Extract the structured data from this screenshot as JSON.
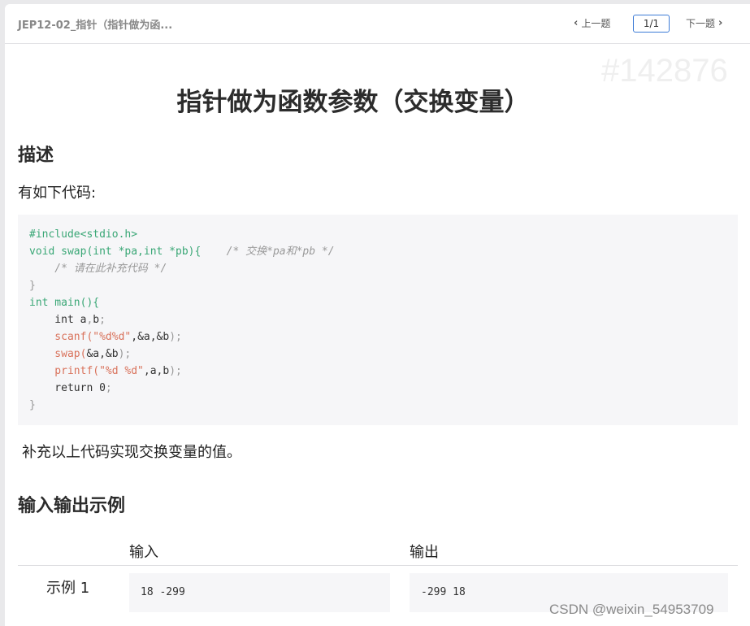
{
  "header": {
    "breadcrumb": "JEP12-02_指针（指针做为函...",
    "prev_label": "上一题",
    "prev_icon": "chevron-left-icon",
    "page_indicator": "1/1",
    "next_label": "下一题",
    "next_icon": "chevron-right-icon",
    "accent_color": "#3d7bd6"
  },
  "problem": {
    "id_watermark": "#142876",
    "title": "指针做为函数参数（交换变量）",
    "description_heading": "描述",
    "intro_text": "有如下代码:",
    "code_lines": [
      [
        {
          "t": "#include<stdio.h>",
          "c": "g"
        }
      ],
      [
        {
          "t": "void swap(int *pa,int *pb){",
          "c": "g"
        },
        {
          "t": "    /* 交换*pa和*pb */",
          "c": "cm"
        }
      ],
      [
        {
          "t": "    /* 请在此补充代码 */",
          "c": "cm"
        }
      ],
      [
        {
          "t": "}",
          "c": "gray"
        }
      ],
      [
        {
          "t": "int",
          "c": "kw"
        },
        {
          "t": " main(){",
          "c": "g"
        }
      ],
      [
        {
          "t": "    int a",
          "c": ""
        },
        {
          "t": ",",
          "c": "gray"
        },
        {
          "t": "b",
          "c": ""
        },
        {
          "t": ";",
          "c": "gray"
        }
      ],
      [
        {
          "t": "    scanf(",
          "c": "str"
        },
        {
          "t": "\"%d%d\"",
          "c": "str"
        },
        {
          "t": ",&a,&b",
          "c": ""
        },
        {
          "t": ");",
          "c": "gray"
        }
      ],
      [
        {
          "t": "    swap(",
          "c": "str"
        },
        {
          "t": "&a,&b",
          "c": ""
        },
        {
          "t": ");",
          "c": "gray"
        }
      ],
      [
        {
          "t": "    printf(",
          "c": "str"
        },
        {
          "t": "\"%d %d\"",
          "c": "str"
        },
        {
          "t": ",a,b",
          "c": ""
        },
        {
          "t": ");",
          "c": "gray"
        }
      ],
      [
        {
          "t": "    return 0",
          "c": ""
        },
        {
          "t": ";",
          "c": "gray"
        }
      ],
      [
        {
          "t": "}",
          "c": "gray"
        }
      ]
    ],
    "outro_text": "补充以上代码实现交换变量的值。",
    "io_heading": "输入输出示例",
    "io_table": {
      "headers": [
        "输入",
        "输出"
      ],
      "rows": [
        {
          "label": "示例 1",
          "input": "18 -299",
          "output": "-299 18"
        }
      ]
    }
  },
  "footer_watermark": "CSDN @weixin_54953709"
}
